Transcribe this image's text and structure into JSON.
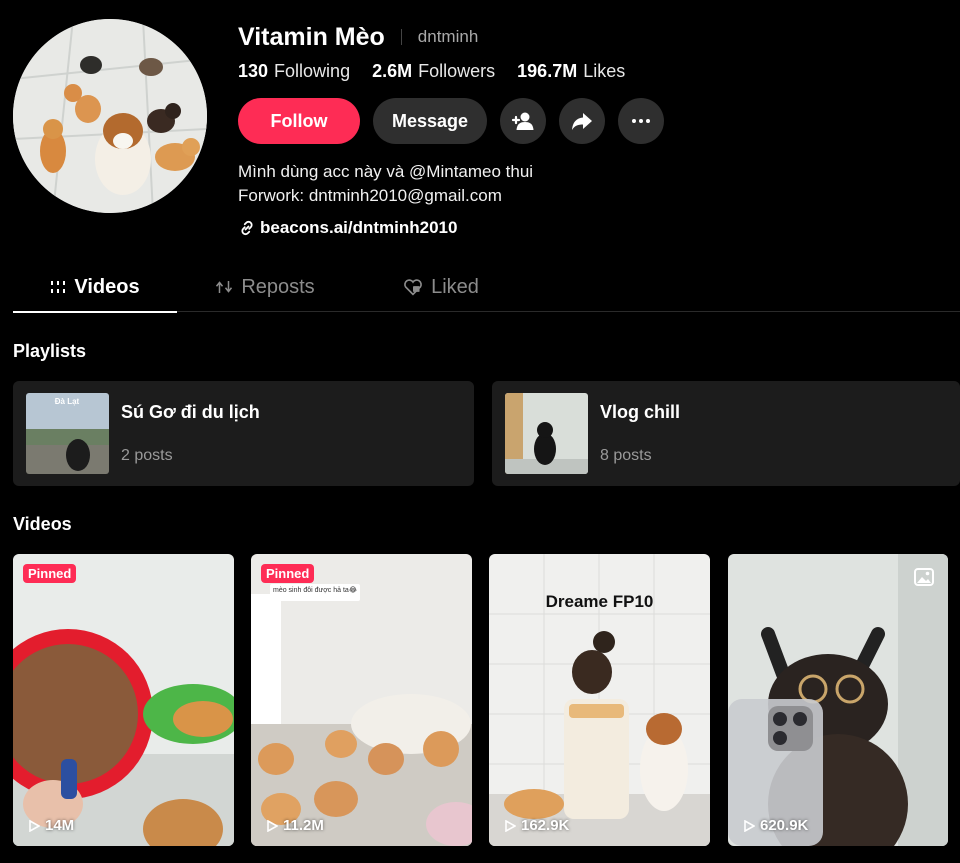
{
  "profile": {
    "name": "Vitamin Mèo",
    "handle": "dntminh",
    "stats": [
      {
        "value": "130",
        "label": "Following"
      },
      {
        "value": "2.6M",
        "label": "Followers"
      },
      {
        "value": "196.7M",
        "label": "Likes"
      }
    ],
    "follow_label": "Follow",
    "message_label": "Message",
    "bio_line1": "Mình dùng acc này và @Mintameo thui",
    "bio_line2": "Forwork: dntminh2010@gmail.com",
    "link": "beacons.ai/dntminh2010"
  },
  "tabs": [
    {
      "label": "Videos",
      "icon": "grid-icon",
      "active": true
    },
    {
      "label": "Reposts",
      "icon": "repost-icon",
      "active": false
    },
    {
      "label": "Liked",
      "icon": "heart-lock-icon",
      "active": false
    }
  ],
  "playlists_title": "Playlists",
  "playlists": [
    {
      "name": "Sú Gơ đi du lịch",
      "count": "2 posts",
      "thumb_text": "Đà Lạt"
    },
    {
      "name": "Vlog chill",
      "count": "8 posts"
    }
  ],
  "videos_title": "Videos",
  "videos": [
    {
      "views": "14M",
      "pinned": "Pinned"
    },
    {
      "views": "11.2M",
      "pinned": "Pinned",
      "bubble": "mèo sinh đôi được hả ta😂"
    },
    {
      "views": "162.9K",
      "overlay": "Dreame FP10"
    },
    {
      "views": "620.9K",
      "icon": "photo-icon"
    }
  ],
  "colors": {
    "accent": "#fe2c55",
    "button_bg": "#2f2f2f",
    "card_bg": "#1c1c1c"
  }
}
